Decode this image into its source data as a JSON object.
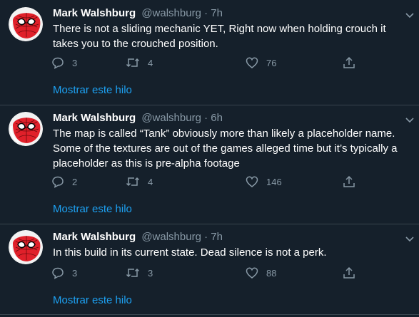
{
  "colors": {
    "background": "#15202b",
    "text": "#ffffff",
    "muted": "#8899a6",
    "link": "#1da1f2",
    "divider": "#38444d",
    "avatar_red": "#e0202a"
  },
  "tweets": [
    {
      "name": "Mark Walshburg",
      "handle": "@walshburg",
      "sep": "·",
      "time": "7h",
      "text": "There is not a sliding mechanic YET, Right now when holding crouch it takes you to the crouched position.",
      "replies": "3",
      "retweets": "4",
      "likes": "76",
      "show_thread": "Mostrar este hilo"
    },
    {
      "name": "Mark Walshburg",
      "handle": "@walshburg",
      "sep": "·",
      "time": "6h",
      "text": "The map is called “Tank” obviously more than likely a placeholder name. Some of the textures are out of the games alleged time but it’s typically a placeholder as this is pre-alpha footage",
      "replies": "2",
      "retweets": "4",
      "likes": "146",
      "show_thread": "Mostrar este hilo"
    },
    {
      "name": "Mark Walshburg",
      "handle": "@walshburg",
      "sep": "·",
      "time": "7h",
      "text": "In this build in its current state. Dead silence is not a perk.",
      "replies": "3",
      "retweets": "3",
      "likes": "88",
      "show_thread": "Mostrar este hilo"
    }
  ],
  "icons": {
    "avatar": "spiderman-avatar-icon",
    "caret": "chevron-down-icon",
    "reply": "reply-bubble-icon",
    "retweet": "retweet-icon",
    "like": "heart-icon",
    "share": "share-upload-icon"
  }
}
